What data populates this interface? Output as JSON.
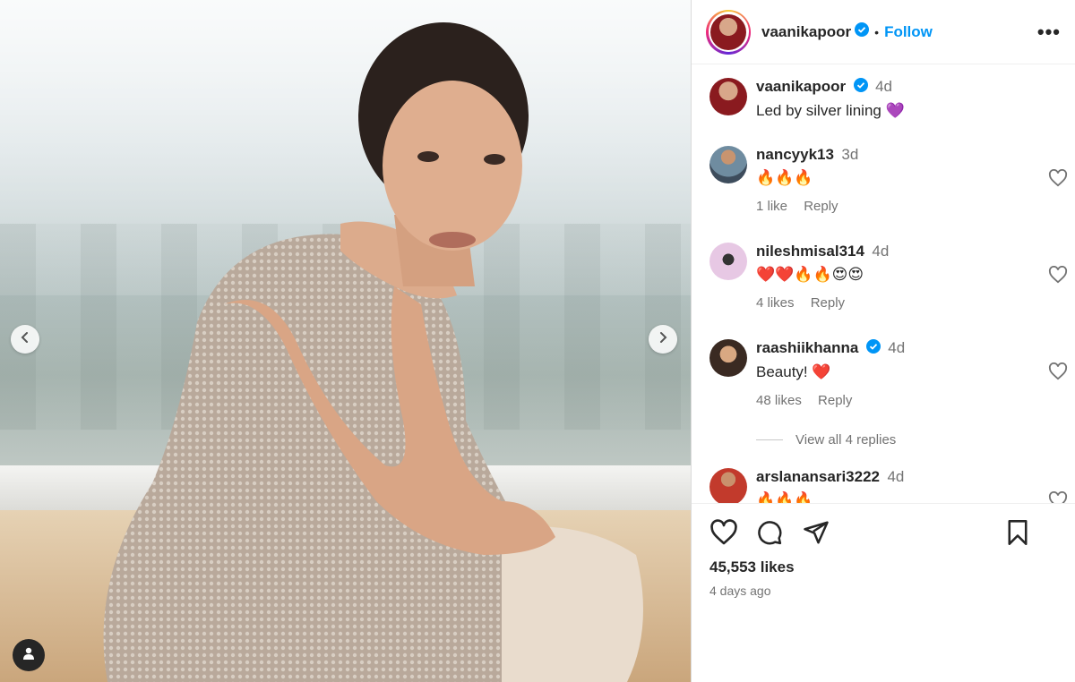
{
  "post": {
    "author": "vaanikapoor",
    "follow_label": "Follow",
    "separator": "•",
    "more_label": "•••",
    "likes": "45,553 likes",
    "time_ago": "4 days ago"
  },
  "caption": {
    "user": "vaanikapoor",
    "time": "4d",
    "text": "Led by silver lining 💜"
  },
  "comments": [
    {
      "user": "nancyyk13",
      "time": "3d",
      "text": "🔥🔥🔥",
      "likes": "1 like",
      "reply": "Reply"
    },
    {
      "user": "nileshmisal314",
      "time": "4d",
      "text": "❤️❤️🔥🔥😍😍",
      "likes": "4 likes",
      "reply": "Reply"
    },
    {
      "user": "raashiikhanna",
      "time": "4d",
      "text": "Beauty! ❤️",
      "likes": "48 likes",
      "reply": "Reply"
    },
    {
      "user": "arslanansari3222",
      "time": "4d",
      "text": "🔥🔥🔥",
      "likes": "",
      "reply": ""
    }
  ],
  "view_replies": "View all 4 replies",
  "colors": {
    "accent": "#0095f6",
    "verified": "#0095f6",
    "text": "#262626",
    "muted": "#737373"
  },
  "icons": {
    "like": "heart-icon",
    "comment": "comment-icon",
    "share": "share-icon",
    "save": "bookmark-icon",
    "prev": "chevron-left-icon",
    "next": "chevron-right-icon",
    "tag": "user-tag-icon"
  }
}
